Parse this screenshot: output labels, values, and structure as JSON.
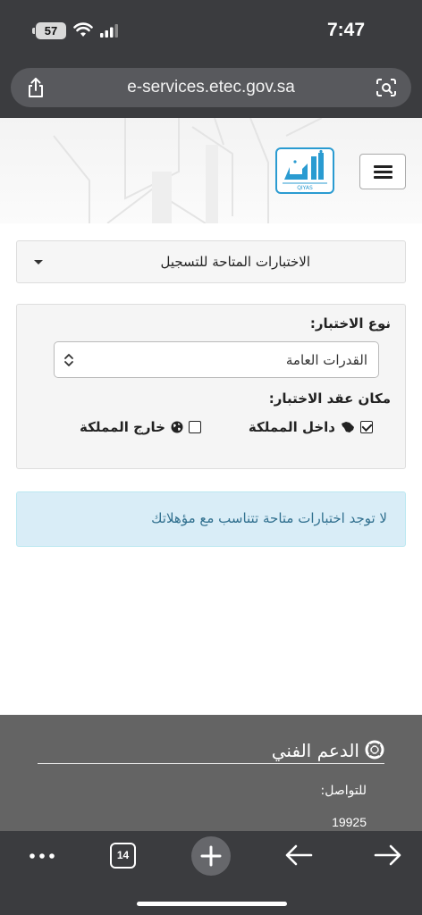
{
  "status_bar": {
    "time": "7:47",
    "battery": "57"
  },
  "browser": {
    "url": "e-services.etec.gov.sa",
    "tab_count": "14"
  },
  "site": {
    "logo_alt": "QIYAS"
  },
  "available_tests": {
    "label": "الاختبارات المتاحة للتسجيل"
  },
  "filter": {
    "test_type_label": "نوع الاختبار:",
    "test_type_value": "القدرات العامة",
    "location_label": "مكان عقد الاختبار:",
    "inside_label": "داخل المملكة",
    "inside_checked": true,
    "outside_label": "خارج المملكة",
    "outside_checked": false
  },
  "alert": {
    "message": "لا توجد اختبارات متاحة تتناسب مع مؤهلاتك"
  },
  "footer": {
    "support_title": "الدعم الفني",
    "contact_label": "للتواصل:",
    "phone": "19925"
  },
  "colors": {
    "accent": "#2a9bd1",
    "alert_bg": "#d9edf7",
    "alert_text": "#31708f",
    "footer_bg": "#646464"
  }
}
